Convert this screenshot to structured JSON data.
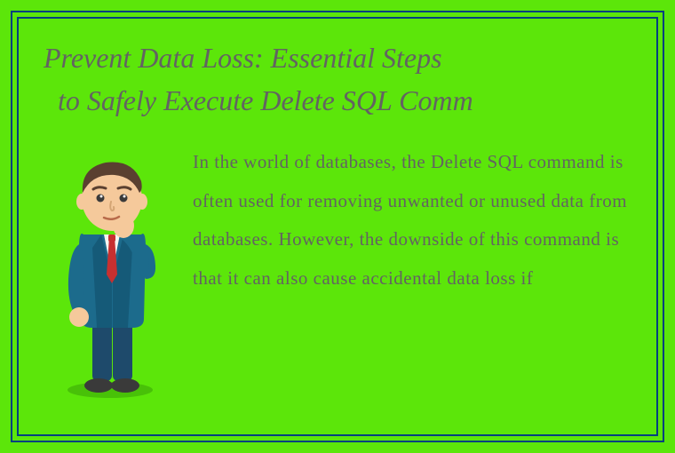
{
  "heading": {
    "line1": "Prevent Data Loss: Essential Steps",
    "line2": " to Safely Execute Delete SQL Comm"
  },
  "body": "In the world of databases, the Delete SQL command is often used for removing unwanted or unused data from databases. However, the downside of this command is that it can also cause accidental data loss if",
  "illustration": {
    "name": "thinking-businessman"
  }
}
